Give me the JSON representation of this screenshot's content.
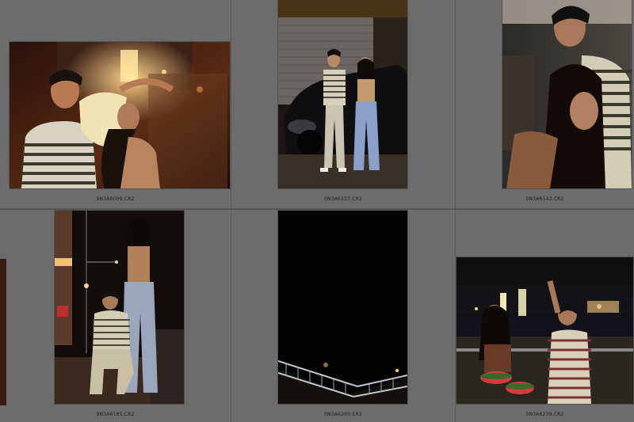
{
  "app": {
    "view": "grid-library"
  },
  "thumbnails": [
    {
      "file": "0N3A6099.CR2",
      "scene": "street-night-couple-hat"
    },
    {
      "file": "0N3A6117.CR2",
      "scene": "couple-leaning-on-car"
    },
    {
      "file": "0N3A6142.CR2",
      "scene": "couple-embrace-closeup"
    },
    {
      "file": "0N3A6185.CR2",
      "scene": "couple-street-corner"
    },
    {
      "file": "0N3A6200.CR2",
      "scene": "dark-sky-railing"
    },
    {
      "file": "0N3A6239.CR2",
      "scene": "watermelon-river-night"
    }
  ],
  "colors": {
    "background": "#6a6a6a",
    "cell_border": "#5b5b5b",
    "label": "#1c1c1c"
  }
}
